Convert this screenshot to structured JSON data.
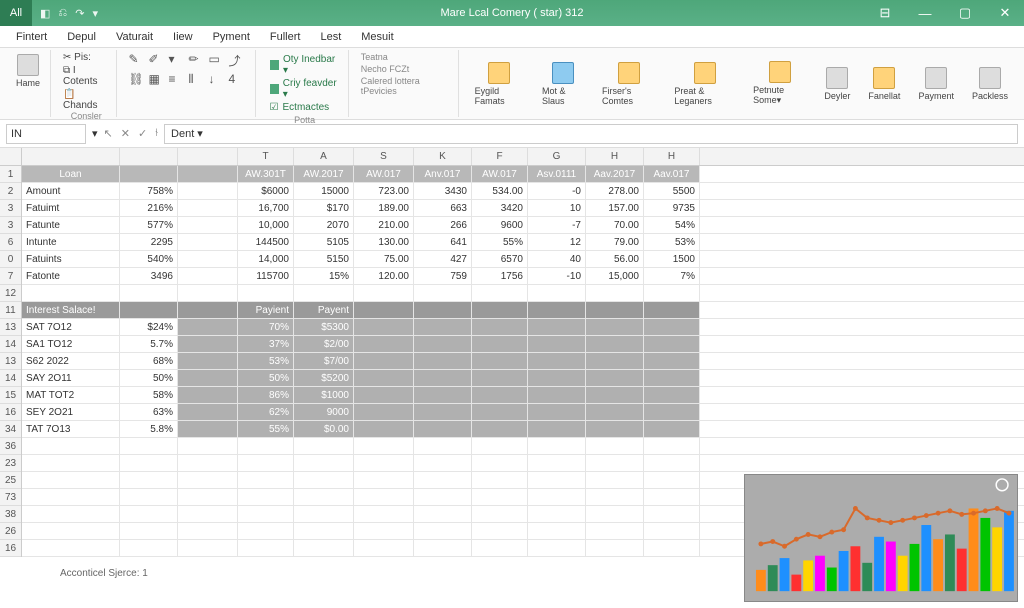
{
  "title": "Mare Lcal Comery (   star)  312",
  "all_btn": "All",
  "qat": [
    "◧",
    "⎌",
    "↷",
    "▾"
  ],
  "win": [
    "⊟",
    "—",
    "▢",
    "✕"
  ],
  "menus": [
    "Fintert",
    "Depul",
    "Vaturait",
    "Iiew",
    "Pyment",
    "Fullert",
    "Lest",
    "Mesuit"
  ],
  "ribbon": {
    "home": "Hame",
    "clip_items": [
      "✂ Pis:",
      "⧉ I Cotents",
      "📋 Chands"
    ],
    "clip_label": "Consler",
    "cond": [
      "Oty Inedbar ▾",
      "Criy feavder ▾",
      "Ectmactes"
    ],
    "cond_label": "Potta",
    "text_items": [
      "Teatna",
      "Necho FCZt",
      "Calered lottera  tPevicies"
    ],
    "big_btns": [
      "Eygild Famats",
      "Mot & Slaus",
      "Firser's Comtes",
      "Preat & Leganers",
      "Petnute Some▾",
      "Deyler",
      "Fanellat",
      "Payment",
      "Packless"
    ]
  },
  "namebox": "IN",
  "fb_text": "Dent ▾",
  "colhdrs": [
    "",
    "",
    "",
    "T",
    "A",
    "S",
    "K",
    "F",
    "G",
    "H",
    "H"
  ],
  "rownums": [
    "1",
    "2",
    "3",
    "3",
    "6",
    "0",
    "7",
    "12",
    "11",
    "13",
    "14",
    "13",
    "14",
    "15",
    "16",
    "34",
    "36",
    "23",
    "25",
    "73",
    "38",
    "26",
    "16"
  ],
  "table1": {
    "header": [
      "Loan",
      "",
      "",
      "AW.301T",
      "AW.2017",
      "AW.017",
      "Anv.017",
      "AW.017",
      "Asv.0111",
      "Aav.2017",
      "Aav.017"
    ],
    "rows": [
      [
        "Amount",
        "758%",
        "",
        "$6000",
        "15000",
        "723.00",
        "3430",
        "534.00",
        "-0",
        "278.00",
        "5500"
      ],
      [
        "Fatuimt",
        "216%",
        "",
        "16,700",
        "$170",
        "189.00",
        "663",
        "3420",
        "10",
        "157.00",
        "9735"
      ],
      [
        "Fatunte",
        "577%",
        "",
        "10,000",
        "2070",
        "210.00",
        "266",
        "9600",
        "-7",
        "70.00",
        "54%"
      ],
      [
        "Intunte",
        "2295",
        "",
        "144500",
        "5105",
        "130.00",
        "641",
        "55%",
        "12",
        "79.00",
        "53%"
      ],
      [
        "Fatuints",
        "540%",
        "",
        "14,000",
        "5150",
        "75.00",
        "427",
        "6570",
        "40",
        "56.00",
        "1500"
      ],
      [
        "Fatonte",
        "3496",
        "",
        "115700",
        "15%",
        "120.00",
        "759",
        "1756",
        "-10",
        "15,000",
        "7%"
      ]
    ]
  },
  "table2": {
    "header": [
      "Interest Salace!",
      "",
      "",
      "Payient",
      "Payent"
    ],
    "rows": [
      [
        "SAT 7O12",
        "$24%",
        "",
        "70%",
        "$5300"
      ],
      [
        "SA1 TO12",
        "5.7%",
        "",
        "37%",
        "$2/00"
      ],
      [
        "S62 2022",
        "68%",
        "",
        "53%",
        "$7/00"
      ],
      [
        "SAY 2O11",
        "50%",
        "",
        "50%",
        "$5200"
      ],
      [
        "MAT TOT2",
        "58%",
        "",
        "86%",
        "$1000"
      ],
      [
        "SEY 2O21",
        "63%",
        "",
        "62%",
        "9000"
      ],
      [
        "TAT 7O13",
        "5.8%",
        "",
        "55%",
        "$0.00"
      ]
    ]
  },
  "footer": "Acconticel Sjerce: 1",
  "chart_data": {
    "type": "bar",
    "title": "",
    "categories": [
      "1",
      "2",
      "3",
      "4",
      "5",
      "6",
      "7",
      "8",
      "9",
      "10",
      "11",
      "12",
      "13",
      "14",
      "15",
      "16",
      "17",
      "18",
      "19",
      "20",
      "21",
      "22"
    ],
    "series": [
      {
        "name": "bars",
        "values": [
          18,
          22,
          28,
          14,
          26,
          30,
          20,
          34,
          38,
          24,
          46,
          42,
          30,
          40,
          56,
          44,
          48,
          36,
          70,
          62,
          54,
          68
        ],
        "colors": [
          "#ff8c1a",
          "#2e8b57",
          "#1e90ff",
          "#ff3030",
          "#ffd500",
          "#ff00ff",
          "#00c400",
          "#1e90ff",
          "#ff3030",
          "#2e8b57",
          "#1e90ff",
          "#ff00ff",
          "#ffd500",
          "#00c400",
          "#1e90ff",
          "#ff8c1a",
          "#2e8b57",
          "#ff3030",
          "#ff8c1a",
          "#00c400",
          "#ffd500",
          "#1e90ff"
        ]
      },
      {
        "name": "line",
        "values": [
          40,
          42,
          38,
          44,
          48,
          46,
          50,
          52,
          70,
          62,
          60,
          58,
          60,
          62,
          64,
          66,
          68,
          65,
          66,
          68,
          70,
          66
        ],
        "color": "#d96a2b"
      }
    ],
    "ylim": [
      0,
      80
    ]
  }
}
